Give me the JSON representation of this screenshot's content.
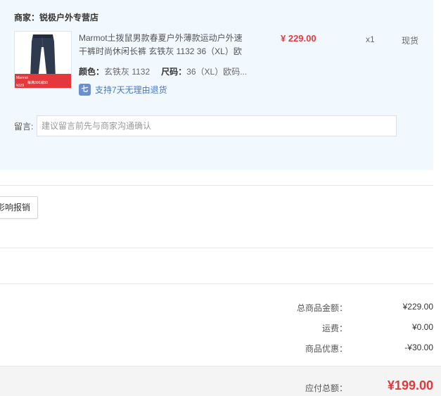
{
  "shop": {
    "label": "商家：",
    "name": "锐极户外专营店"
  },
  "product": {
    "title": "Marmot土拨鼠男款春夏户外薄款运动户外速干裤时尚休闲长裤 玄铁灰 1132 36（XL）欧",
    "price": "¥ 229.00",
    "quantity": "x1",
    "stock_status": "现货",
    "attrs": {
      "color_label": "颜色：",
      "color_value": "玄铁灰 1132",
      "size_label": "尺码：",
      "size_value": "36（XL）欧码..."
    },
    "return_policy": {
      "icon": "return-7day-icon",
      "icon_glyph": "七",
      "text": "支持7天无理由退货"
    },
    "thumb_tags": {
      "brand": "Marmot",
      "promo": "每满300减50",
      "price": "¥229"
    }
  },
  "note": {
    "label": "留言:",
    "placeholder": "建议留言前先与商家沟通确认",
    "value": ""
  },
  "invoice": {
    "button_label": "影响报销"
  },
  "summary": {
    "goods_total_label": "总商品金额：",
    "goods_total_value": "¥229.00",
    "shipping_label": "运费：",
    "shipping_value": "¥0.00",
    "discount_label": "商品优惠：",
    "discount_value": "-¥30.00"
  },
  "total": {
    "label": "应付总额：",
    "value": "¥199.00"
  },
  "colors": {
    "accent_red": "#e4393c",
    "panel_bg": "#f2f9fe",
    "link_blue": "#4a76c0"
  }
}
